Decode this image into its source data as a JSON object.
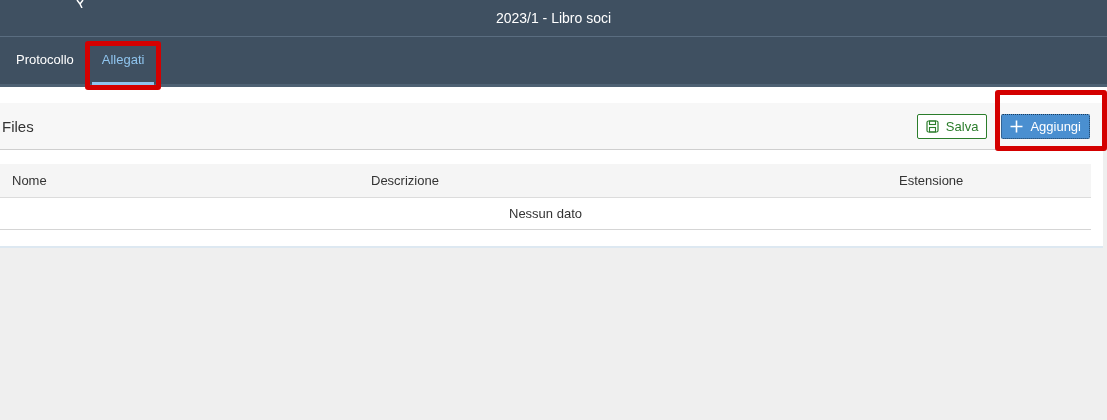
{
  "window": {
    "title": "2023/1 - Libro soci"
  },
  "tabs": [
    {
      "label": "Protocollo",
      "selected": false,
      "highlighted": false
    },
    {
      "label": "Allegati",
      "selected": true,
      "highlighted": true
    }
  ],
  "toolbar": {
    "title": "Files",
    "buttons": [
      {
        "kind": "save",
        "label": "Salva",
        "highlighted": false
      },
      {
        "kind": "add",
        "label": "Aggiungi",
        "highlighted": true
      }
    ]
  },
  "table": {
    "columns": [
      "Nome",
      "Descrizione",
      "Estensione"
    ],
    "empty_text": "Nessun dato"
  }
}
